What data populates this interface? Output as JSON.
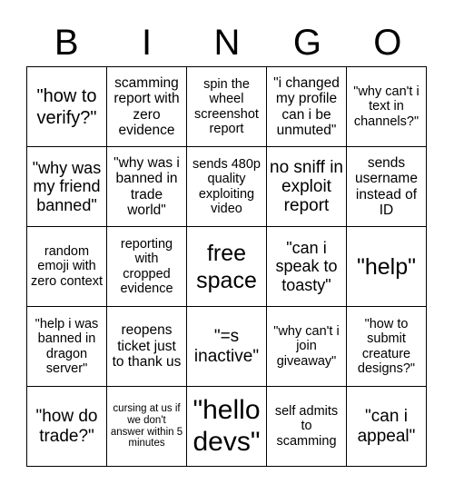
{
  "title_letters": [
    "B",
    "I",
    "N",
    "G",
    "O"
  ],
  "cells": [
    [
      "\"how to verify?\"",
      "scamming report with zero evidence",
      "spin the wheel screenshot report",
      "\"i changed my profile can i be unmuted\"",
      "\"why can't i text in channels?\""
    ],
    [
      "\"why was my friend banned\"",
      "\"why was i banned in trade world\"",
      "sends 480p quality exploiting video",
      "no sniff in exploit report",
      "sends username instead of ID"
    ],
    [
      "random emoji with zero context",
      "reporting with cropped evidence",
      "free space",
      "\"can i speak to toasty\"",
      "\"help\""
    ],
    [
      "\"help i was banned in dragon server\"",
      "reopens ticket just to thank us",
      "\"=s inactive\"",
      "\"why can't i join giveaway\"",
      "\"how to submit creature designs?\""
    ],
    [
      "\"how do trade?\"",
      "cursing at us if we don't answer within 5 minutes",
      "\"hello devs\"",
      "self admits to scamming",
      "\"can i appeal\""
    ]
  ]
}
